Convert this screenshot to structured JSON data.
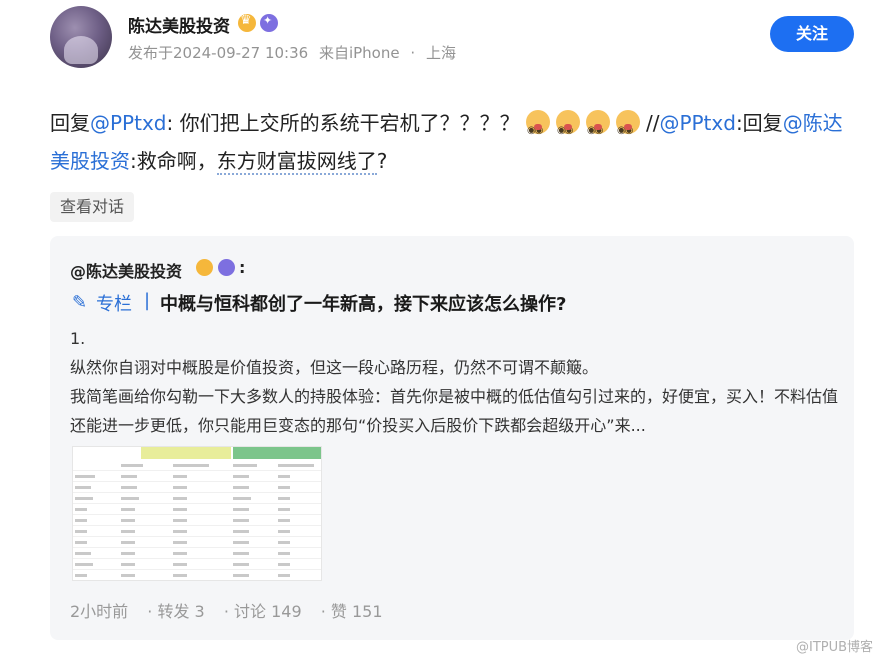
{
  "post": {
    "author": "陈达美股投资",
    "published": "发布于2024-09-27 10:36",
    "source": "来自iPhone",
    "dot": "·",
    "location": "上海",
    "follow_label": "关注",
    "text": {
      "reply_prefix": "回复",
      "mention1": "@PPtxd",
      "body1": ": 你们把上交所的系统干宕机了？？？？ ",
      "slash": "//",
      "mention2": "@PPtxd",
      "body2": ":回复",
      "mention3": "@陈达美股投资",
      "body3": ":救命啊，",
      "highlight": "东方财富拔网线了",
      "end": "?"
    },
    "view_conversation": "查看对话"
  },
  "quote": {
    "author": "@陈达美股投资",
    "colon": ":",
    "column_label": "专栏",
    "separator": "|",
    "title": "中概与恒科都创了一年新高，接下来应该怎么操作?",
    "line1": "1.",
    "line2": "纵然你自诩对中概股是价值投资，但这一段心路历程，仍然不可谓不颠簸。",
    "line3": "我简笔画给你勾勒一下大多数人的持股体验：首先你是被中概的低估值勾引过来的，好便宜，买入！不料估值还能进一步更低，你只能用巨变态的那句“价投买入后股价下跌都会超级开心”来...",
    "footer": {
      "time": "2小时前",
      "repost": "· 转发 3",
      "comment": "· 讨论 149",
      "like": "· 赞 151"
    }
  },
  "watermark": "@ITPUB博客",
  "icons": [
    "crown-badge-icon",
    "verified-badge-icon",
    "emoji-icon",
    "column-pen-icon"
  ],
  "colors": {
    "accent": "#1d6ff2",
    "link": "#2a6fd6"
  }
}
